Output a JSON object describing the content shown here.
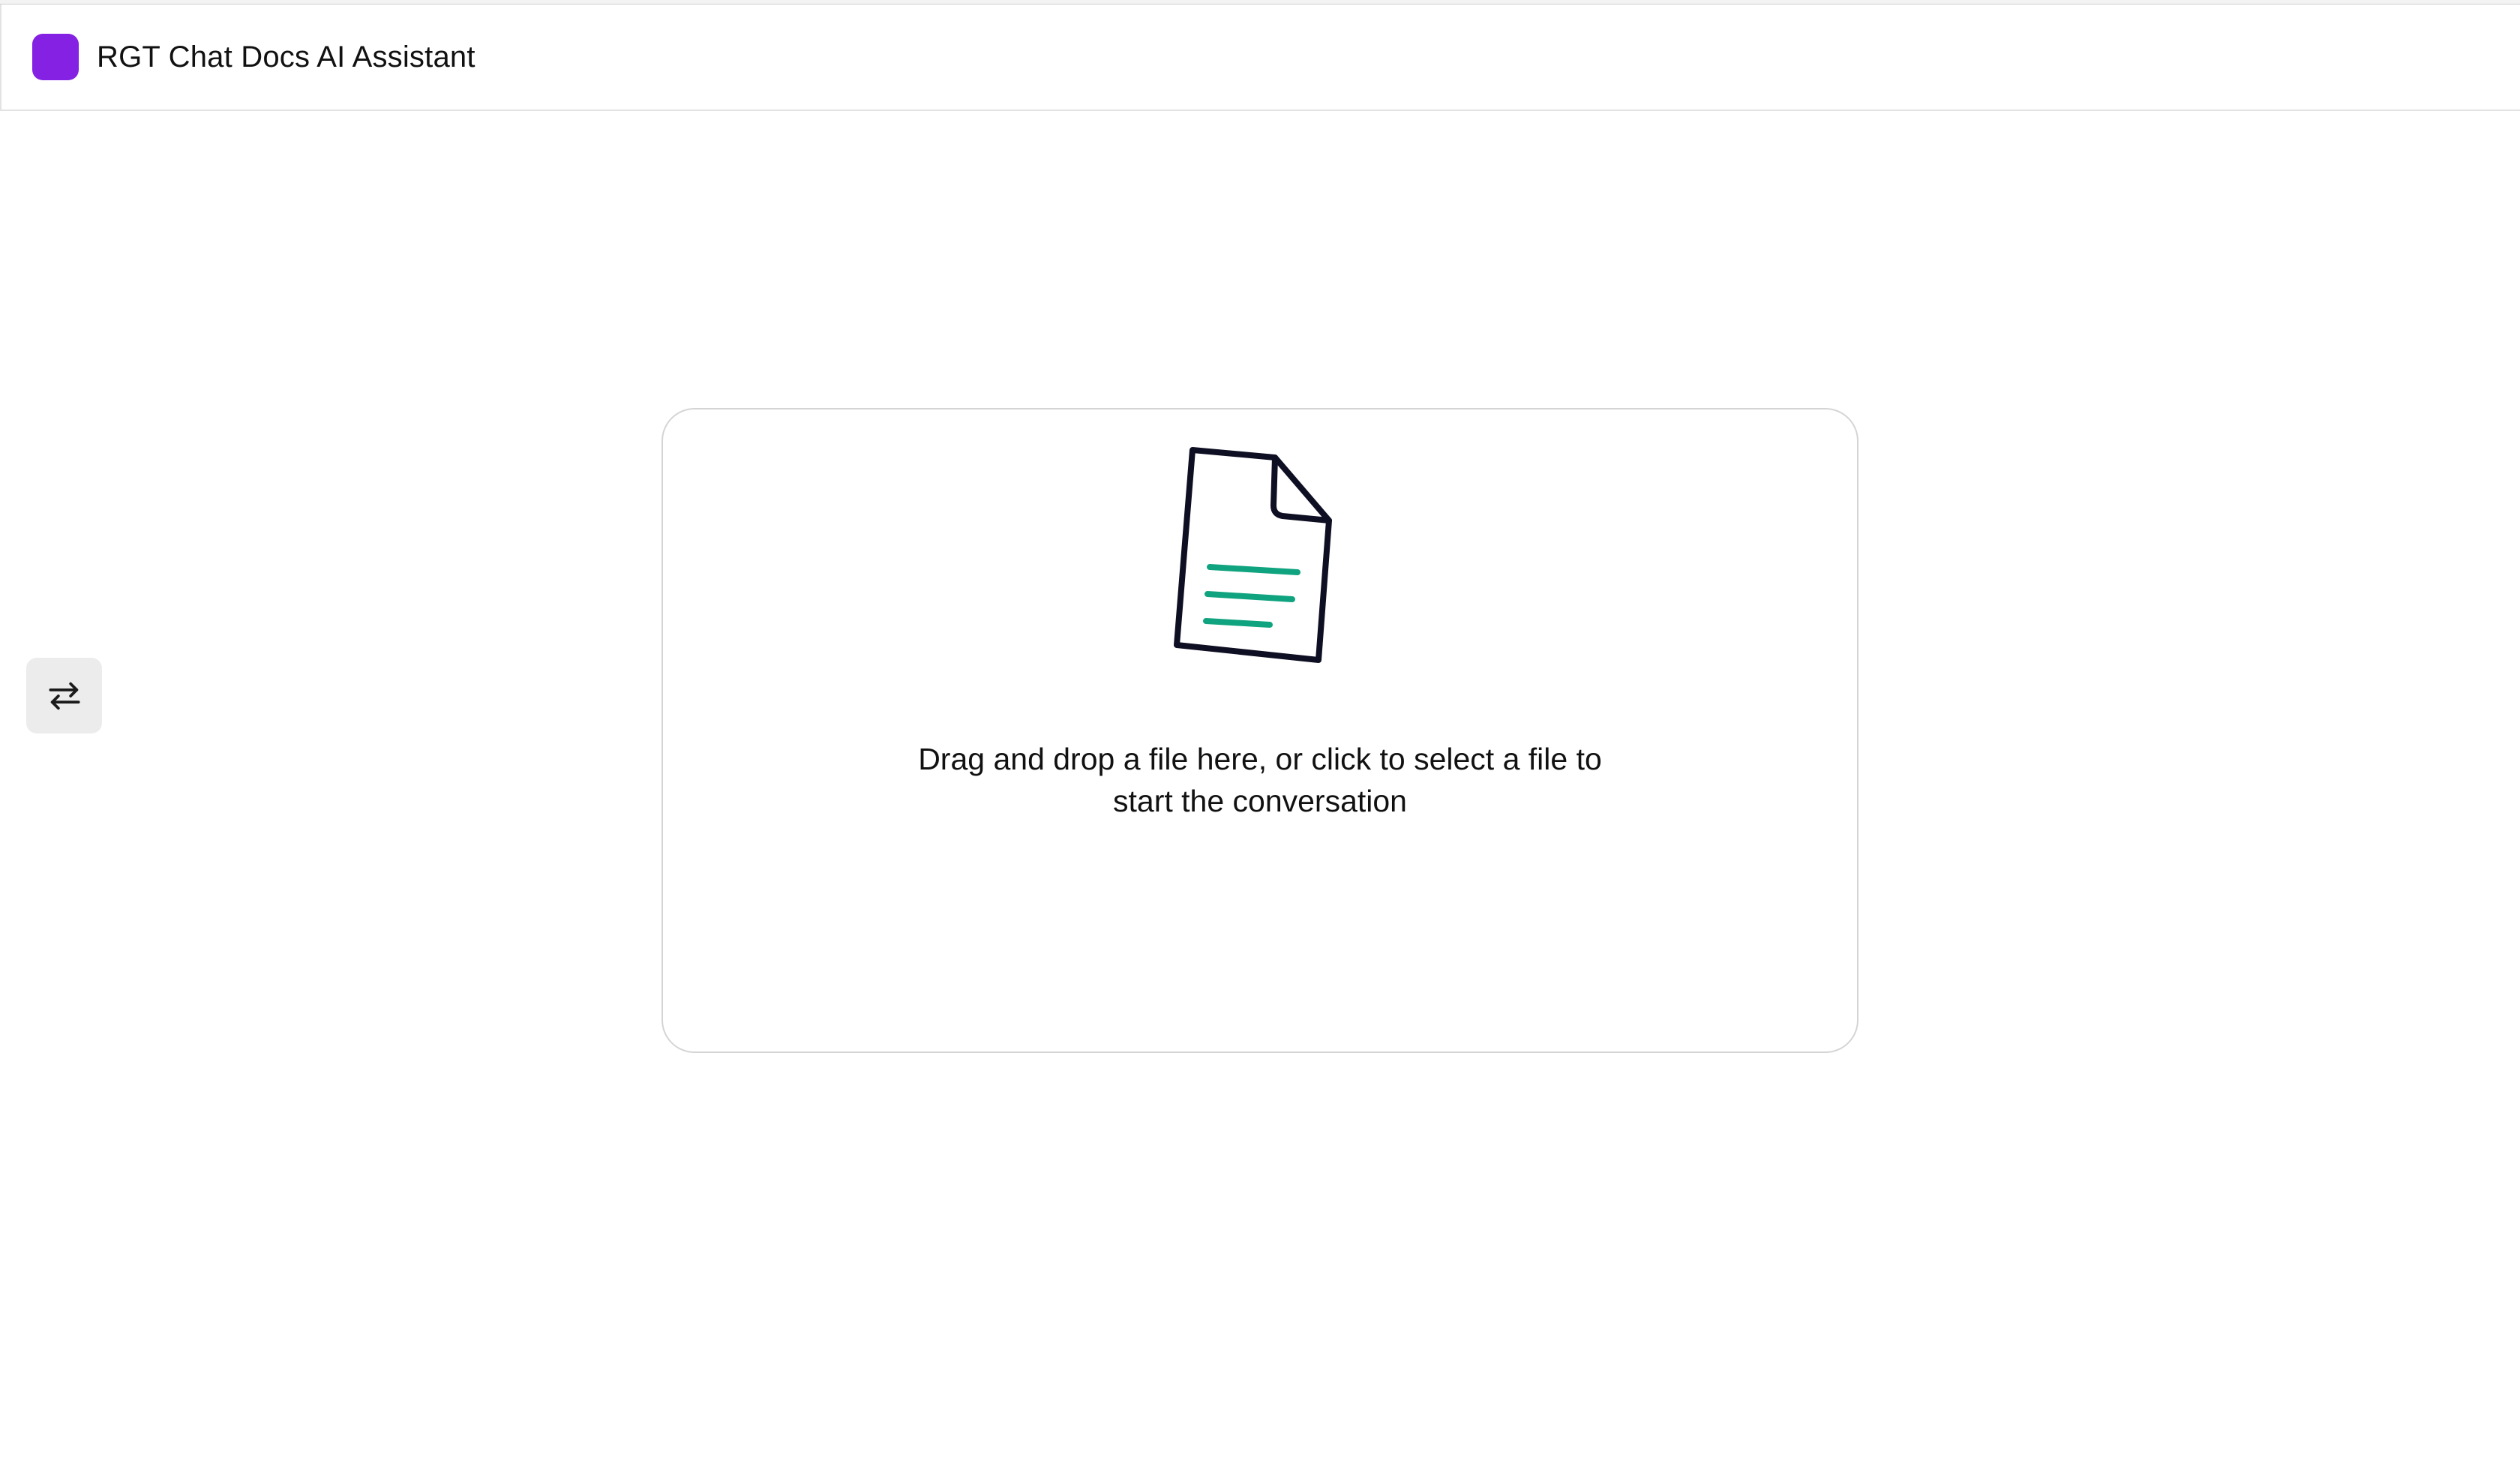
{
  "header": {
    "title": "RGT Chat Docs AI Assistant",
    "logo_color": "#8521e3"
  },
  "sidebar_toggle": {
    "icon": "swap-arrows-icon"
  },
  "dropzone": {
    "icon": "document-icon",
    "text_line1": "Drag and drop a file here, or click to select a file to",
    "text_line2": "start the conversation"
  },
  "colors": {
    "accent": "#8521e3",
    "document_lines": "#10a37f",
    "document_outline": "#0f0f24"
  }
}
